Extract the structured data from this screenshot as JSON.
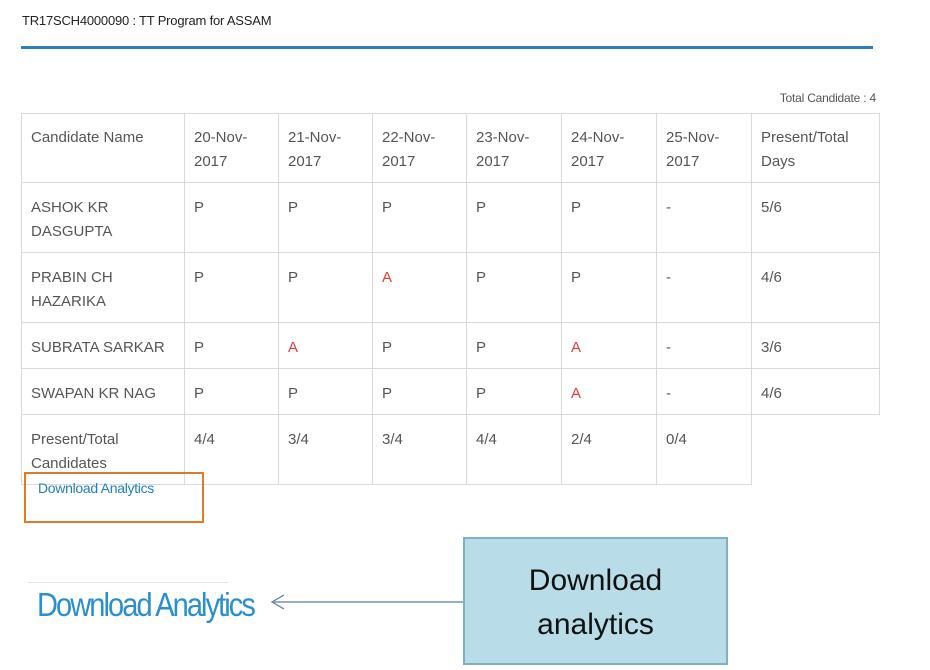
{
  "header": {
    "title": "TR17SCH4000090 : TT Program for ASSAM"
  },
  "summary": {
    "total_candidates": "Total Candidate : 4"
  },
  "table": {
    "headers": [
      "Candidate Name",
      "20-Nov-2017",
      "21-Nov-2017",
      "22-Nov-2017",
      "23-Nov-2017",
      "24-Nov-2017",
      "25-Nov-2017",
      "Present/Total Days"
    ],
    "rows": [
      {
        "name": "ASHOK KR DASGUPTA",
        "days": [
          "P",
          "P",
          "P",
          "P",
          "P",
          "-"
        ],
        "total": "5/6"
      },
      {
        "name": "PRABIN CH HAZARIKA",
        "days": [
          "P",
          "P",
          "A",
          "P",
          "P",
          "-"
        ],
        "total": "4/6"
      },
      {
        "name": "SUBRATA SARKAR",
        "days": [
          "P",
          "A",
          "P",
          "P",
          "A",
          "-"
        ],
        "total": "3/6"
      },
      {
        "name": "SWAPAN KR NAG",
        "days": [
          "P",
          "P",
          "P",
          "P",
          "A",
          "-"
        ],
        "total": "4/6"
      }
    ],
    "footer": {
      "label": "Present/Total Candidates",
      "values": [
        "4/4",
        "3/4",
        "3/4",
        "4/4",
        "2/4",
        "0/4"
      ]
    }
  },
  "download": {
    "link_label": "Download Analytics",
    "large_label": "Download Analytics"
  },
  "callout": {
    "line1": "Download",
    "line2": "analytics"
  },
  "colors": {
    "accent": "#2a7fbf",
    "absent": "#e03a3a",
    "highlight_box": "#e07a2a",
    "callout_bg": "#b8dce8"
  },
  "icons": {
    "arrow": "arrow-left-icon"
  }
}
